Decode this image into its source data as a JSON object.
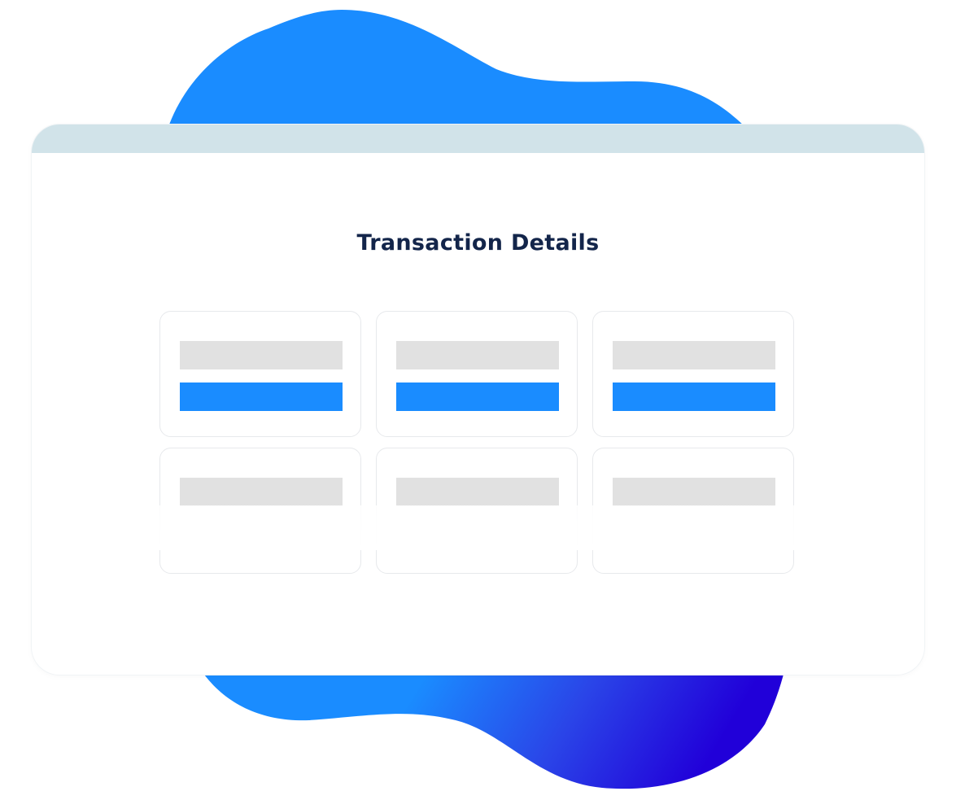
{
  "page": {
    "title": "Transaction Details"
  },
  "colors": {
    "blob_top": "#1a8cff",
    "blob_bottom": "#2100d9",
    "titlebar": "#d1e3e9",
    "title_text": "#13254a",
    "placeholder_gray": "#e1e1e1",
    "placeholder_blue": "#1a8cff"
  },
  "cards": [
    {
      "placeholders": [
        "gray",
        "blue"
      ]
    },
    {
      "placeholders": [
        "gray",
        "blue"
      ]
    },
    {
      "placeholders": [
        "gray",
        "blue"
      ]
    },
    {
      "placeholders": [
        "gray"
      ]
    },
    {
      "placeholders": [
        "gray"
      ]
    },
    {
      "placeholders": [
        "gray"
      ]
    }
  ]
}
